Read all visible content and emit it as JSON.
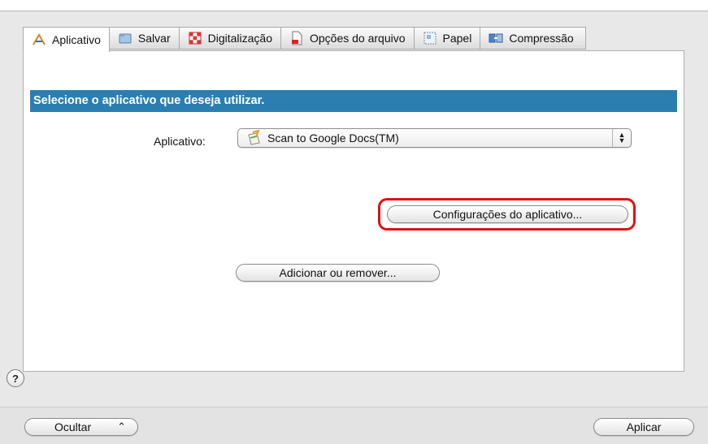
{
  "tabs": [
    {
      "label": "Aplicativo",
      "icon": "aplicativo-icon",
      "active": true
    },
    {
      "label": "Salvar",
      "icon": "salvar-icon",
      "active": false
    },
    {
      "label": "Digitalização",
      "icon": "digitalizacao-icon",
      "active": false
    },
    {
      "label": "Opções do arquivo",
      "icon": "file-options-icon",
      "active": false
    },
    {
      "label": "Papel",
      "icon": "paper-icon",
      "active": false
    },
    {
      "label": "Compressão",
      "icon": "compression-icon",
      "active": false
    }
  ],
  "panel": {
    "header": "Selecione o aplicativo que deseja utilizar.",
    "app_label": "Aplicativo:",
    "app_selected": "Scan to Google Docs(TM)",
    "config_button": "Configurações do aplicativo...",
    "add_remove_button": "Adicionar ou remover..."
  },
  "help_label": "?",
  "bottom": {
    "hide_button": "Ocultar",
    "apply_button": "Aplicar"
  },
  "colors": {
    "header_band": "#2a7fb0",
    "highlight": "#e01010"
  }
}
